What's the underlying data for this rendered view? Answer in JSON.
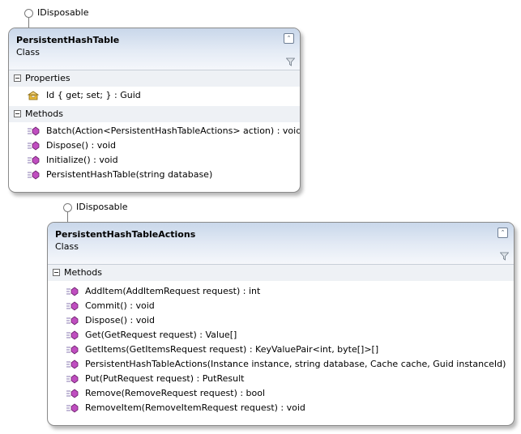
{
  "diagram": {
    "classes": [
      {
        "id": "persistent-hash-table",
        "name": "PersistentHashTable",
        "kind": "Class",
        "interface": "IDisposable",
        "compartments": [
          {
            "title": "Properties",
            "members": [
              {
                "text": "Id { get; set; } : Guid",
                "icon": "property-icon"
              }
            ]
          },
          {
            "title": "Methods",
            "members": [
              {
                "text": "Batch(Action<PersistentHashTableActions> action) : void",
                "icon": "method-icon"
              },
              {
                "text": "Dispose() : void",
                "icon": "method-icon"
              },
              {
                "text": "Initialize() : void",
                "icon": "method-icon"
              },
              {
                "text": "PersistentHashTable(string database)",
                "icon": "method-icon"
              }
            ]
          }
        ]
      },
      {
        "id": "persistent-hash-table-actions",
        "name": "PersistentHashTableActions",
        "kind": "Class",
        "interface": "IDisposable",
        "compartments": [
          {
            "title": "Methods",
            "members": [
              {
                "text": "AddItem(AddItemRequest request) : int",
                "icon": "method-icon"
              },
              {
                "text": "Commit() : void",
                "icon": "method-icon"
              },
              {
                "text": "Dispose() : void",
                "icon": "method-icon"
              },
              {
                "text": "Get(GetRequest request) : Value[]",
                "icon": "method-icon"
              },
              {
                "text": "GetItems(GetItemsRequest request) : KeyValuePair<int, byte[]>[]",
                "icon": "method-icon"
              },
              {
                "text": "PersistentHashTableActions(Instance instance, string database, Cache cache, Guid instanceId)",
                "icon": "method-icon"
              },
              {
                "text": "Put(PutRequest request) : PutResult",
                "icon": "method-icon"
              },
              {
                "text": "Remove(RemoveRequest request) : bool",
                "icon": "method-icon"
              },
              {
                "text": "RemoveItem(RemoveItemRequest request) : void",
                "icon": "method-icon"
              }
            ]
          }
        ]
      }
    ]
  },
  "colors": {
    "header_gradient_top": "#c9d7ea",
    "compartment_header": "#eef1f5",
    "method_icon": "#b23bb0",
    "property_icon": "#d9a520"
  }
}
